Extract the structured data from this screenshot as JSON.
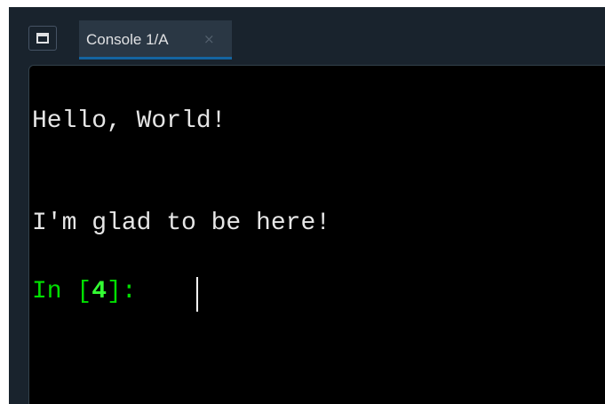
{
  "tabs": [
    {
      "label": "Console 1/A",
      "close_glyph": "×"
    }
  ],
  "console": {
    "output": [
      "Hello, World!",
      "I'm glad to be here!"
    ],
    "prompt": {
      "prefix": "In [",
      "number": "4",
      "suffix": "]: "
    }
  },
  "icons": {
    "pane_button": "window-pane-icon",
    "tab_close": "close-icon"
  },
  "colors": {
    "window_bg": "#19232d",
    "tab_bg": "#2a3744",
    "tab_accent": "#1464a0",
    "console_bg": "#000000",
    "output_text": "#e6e6e6",
    "prompt_green": "#00e000"
  }
}
